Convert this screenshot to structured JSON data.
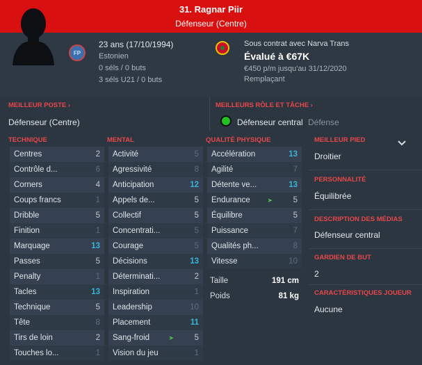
{
  "header": {
    "name": "31. Ragnar Piir",
    "position": "Défenseur (Centre)"
  },
  "profile": {
    "age_line": "23 ans (17/10/1994)",
    "nationality": "Estonien",
    "nat_badge": "FP",
    "caps": "0 séls / 0 buts",
    "u21_caps": "3 séls U21 / 0 buts",
    "contract": "Sous contrat avec Narva Trans",
    "value": "Évalué à €67K",
    "wage": "€450 p/m jusqu'au 31/12/2020",
    "squad_role": "Remplaçant"
  },
  "best_position": {
    "title": "MEILLEUR POSTE",
    "value": "Défenseur (Centre)"
  },
  "best_role": {
    "title": "MEILLEURS RÔLE ET TÂCHE",
    "role": "Défenseur central",
    "duty": "Défense"
  },
  "columns": {
    "technique": "TECHNIQUE",
    "mental": "MENTAL",
    "physical": "QUALITÉ PHYSIQUE"
  },
  "technique": [
    {
      "label": "Centres",
      "value": "2",
      "tone": "mid"
    },
    {
      "label": "Contrôle d...",
      "value": "6",
      "tone": "lo"
    },
    {
      "label": "Corners",
      "value": "4",
      "tone": "mid"
    },
    {
      "label": "Coups francs",
      "value": "1",
      "tone": "lo"
    },
    {
      "label": "Dribble",
      "value": "5",
      "tone": "mid"
    },
    {
      "label": "Finition",
      "value": "1",
      "tone": "lo"
    },
    {
      "label": "Marquage",
      "value": "13",
      "tone": "hi"
    },
    {
      "label": "Passes",
      "value": "5",
      "tone": "mid"
    },
    {
      "label": "Penalty",
      "value": "1",
      "tone": "lo"
    },
    {
      "label": "Tacles",
      "value": "13",
      "tone": "hi"
    },
    {
      "label": "Technique",
      "value": "5",
      "tone": "mid"
    },
    {
      "label": "Tête",
      "value": "8",
      "tone": "lo"
    },
    {
      "label": "Tirs de loin",
      "value": "2",
      "tone": "mid"
    },
    {
      "label": "Touches lo...",
      "value": "1",
      "tone": "lo"
    }
  ],
  "mental": [
    {
      "label": "Activité",
      "value": "5",
      "tone": "lo"
    },
    {
      "label": "Agressivité",
      "value": "8",
      "tone": "lo"
    },
    {
      "label": "Anticipation",
      "value": "12",
      "tone": "hi"
    },
    {
      "label": "Appels de...",
      "value": "5",
      "tone": "mid"
    },
    {
      "label": "Collectif",
      "value": "5",
      "tone": "mid"
    },
    {
      "label": "Concentrati...",
      "value": "5",
      "tone": "lo"
    },
    {
      "label": "Courage",
      "value": "5",
      "tone": "lo"
    },
    {
      "label": "Décisions",
      "value": "13",
      "tone": "hi"
    },
    {
      "label": "Déterminati...",
      "value": "2",
      "tone": "mid"
    },
    {
      "label": "Inspiration",
      "value": "1",
      "tone": "lo"
    },
    {
      "label": "Leadership",
      "value": "10",
      "tone": "lo"
    },
    {
      "label": "Placement",
      "value": "11",
      "tone": "hi"
    },
    {
      "label": "Sang-froid",
      "value": "5",
      "tone": "mid",
      "arrow": true
    },
    {
      "label": "Vision du jeu",
      "value": "1",
      "tone": "lo"
    }
  ],
  "physical": [
    {
      "label": "Accélération",
      "value": "13",
      "tone": "hi"
    },
    {
      "label": "Agilité",
      "value": "7",
      "tone": "lo"
    },
    {
      "label": "Détente ve...",
      "value": "13",
      "tone": "hi"
    },
    {
      "label": "Endurance",
      "value": "5",
      "tone": "mid",
      "arrow": true
    },
    {
      "label": "Équilibre",
      "value": "5",
      "tone": "mid"
    },
    {
      "label": "Puissance",
      "value": "7",
      "tone": "lo"
    },
    {
      "label": "Qualités ph...",
      "value": "8",
      "tone": "lo"
    },
    {
      "label": "Vitesse",
      "value": "10",
      "tone": "lo"
    }
  ],
  "physical_extra": {
    "height_label": "Taille",
    "height_value": "191 cm",
    "weight_label": "Poids",
    "weight_value": "81 kg"
  },
  "right_panel": {
    "best_foot_title": "MEILLEUR PIED",
    "best_foot": "Droitier",
    "personality_title": "PERSONNALITÉ",
    "personality": "Équilibrée",
    "media_title": "DESCRIPTION DES MÉDIAS",
    "media": "Défenseur central",
    "gk_title": "GARDIEN DE BUT",
    "gk": "2",
    "traits_title": "CARACTÉRISTIQUES JOUEUR",
    "traits": "Aucune"
  }
}
